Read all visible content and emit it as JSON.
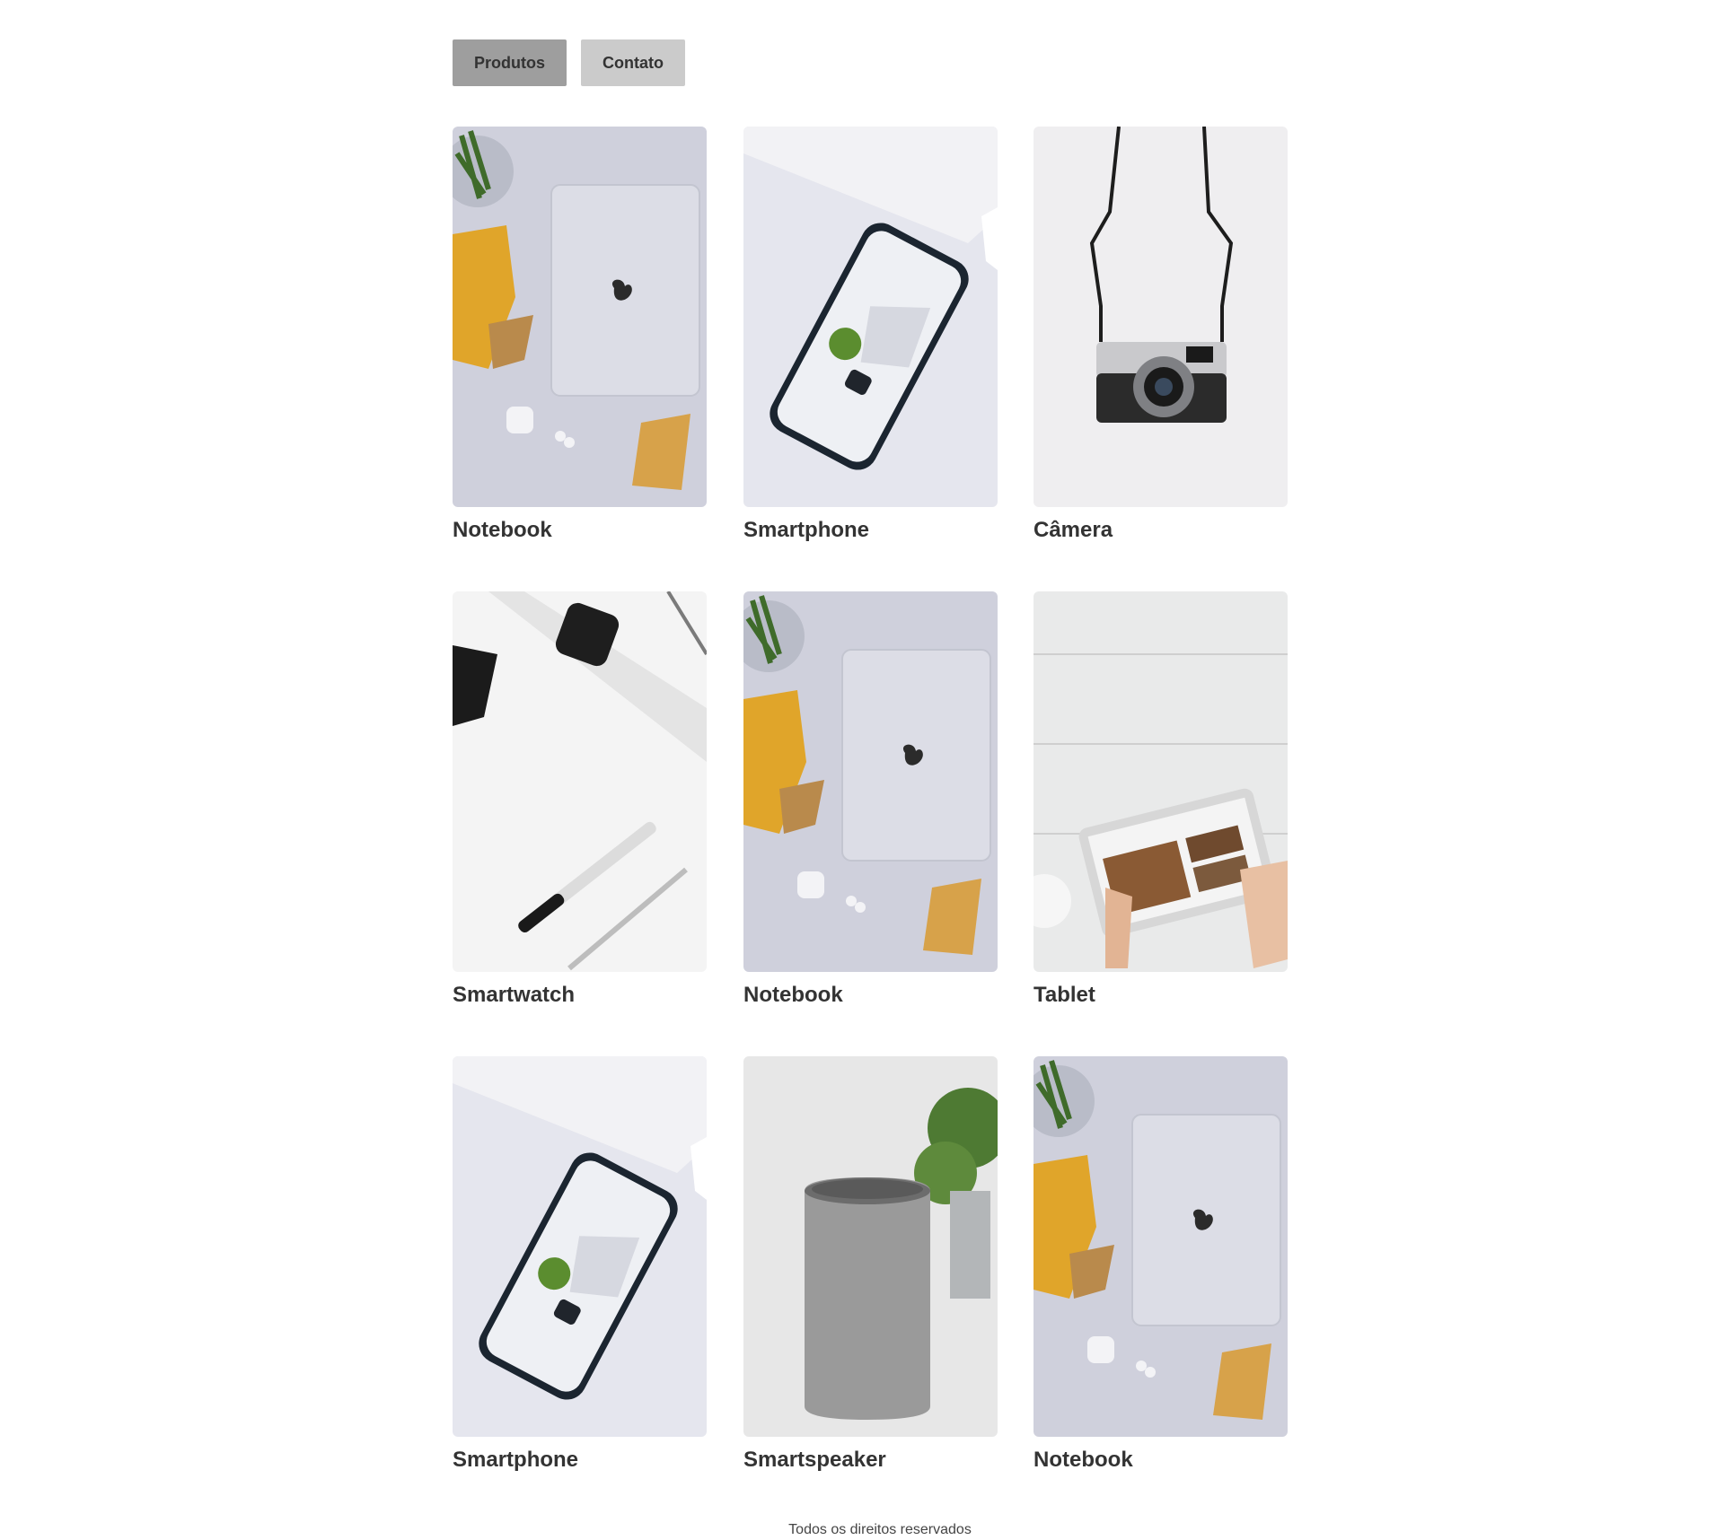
{
  "nav": {
    "items": [
      {
        "label": "Produtos",
        "active": true
      },
      {
        "label": "Contato",
        "active": false
      }
    ]
  },
  "products": [
    {
      "title": "Notebook",
      "image": "notebook-laptop-photo"
    },
    {
      "title": "Smartphone",
      "image": "smartphone-photo"
    },
    {
      "title": "Câmera",
      "image": "camera-photo"
    },
    {
      "title": "Smartwatch",
      "image": "smartwatch-photo"
    },
    {
      "title": "Notebook",
      "image": "notebook-laptop-photo"
    },
    {
      "title": "Tablet",
      "image": "tablet-photo"
    },
    {
      "title": "Smartphone",
      "image": "smartphone-photo"
    },
    {
      "title": "Smartspeaker",
      "image": "smartspeaker-photo"
    },
    {
      "title": "Notebook",
      "image": "notebook-laptop-photo"
    }
  ],
  "footer": {
    "text": "Todos os direitos reservados"
  },
  "colors": {
    "nav_active_bg": "#9e9e9e",
    "nav_inactive_bg": "#cbcbcb",
    "text": "#333333"
  }
}
